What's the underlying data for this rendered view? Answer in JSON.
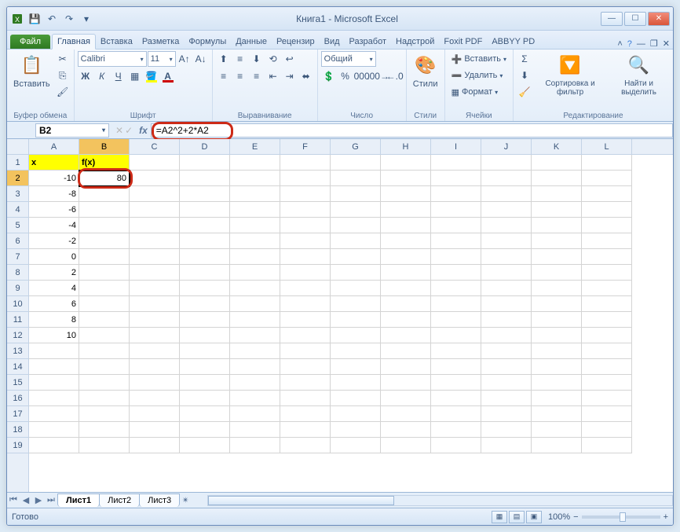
{
  "title": "Книга1 - Microsoft Excel",
  "tabs": {
    "file": "Файл",
    "items": [
      "Главная",
      "Вставка",
      "Разметка",
      "Формулы",
      "Данные",
      "Рецензир",
      "Вид",
      "Разработ",
      "Надстрой",
      "Foxit PDF",
      "ABBYY PD"
    ],
    "active": 0
  },
  "ribbon": {
    "clipboard": {
      "label": "Буфер обмена",
      "paste": "Вставить"
    },
    "font": {
      "label": "Шрифт",
      "name": "Calibri",
      "size": "11"
    },
    "alignment": {
      "label": "Выравнивание"
    },
    "number": {
      "label": "Число",
      "format": "Общий"
    },
    "styles": {
      "label": "Стили",
      "btn": "Стили"
    },
    "cells": {
      "label": "Ячейки",
      "insert": "Вставить",
      "delete": "Удалить",
      "format": "Формат"
    },
    "editing": {
      "label": "Редактирование",
      "sort": "Сортировка и фильтр",
      "find": "Найти и выделить"
    }
  },
  "namebox": "B2",
  "formula": "=A2^2+2*A2",
  "columns": [
    "A",
    "B",
    "C",
    "D",
    "E",
    "F",
    "G",
    "H",
    "I",
    "J",
    "K",
    "L"
  ],
  "rows": [
    "1",
    "2",
    "3",
    "4",
    "5",
    "6",
    "7",
    "8",
    "9",
    "10",
    "11",
    "12",
    "13",
    "14",
    "15",
    "16",
    "17",
    "18",
    "19"
  ],
  "headers": {
    "A1": "x",
    "B1": "f(x)"
  },
  "chart_data": {
    "type": "table",
    "columns": [
      "x",
      "f(x)"
    ],
    "x": [
      -10,
      -8,
      -6,
      -4,
      -2,
      0,
      2,
      4,
      6,
      8,
      10
    ],
    "fx": [
      80,
      null,
      null,
      null,
      null,
      null,
      null,
      null,
      null,
      null,
      null
    ]
  },
  "sheets": {
    "items": [
      "Лист1",
      "Лист2",
      "Лист3"
    ],
    "active": 0
  },
  "status": {
    "ready": "Готово",
    "zoom": "100%"
  }
}
